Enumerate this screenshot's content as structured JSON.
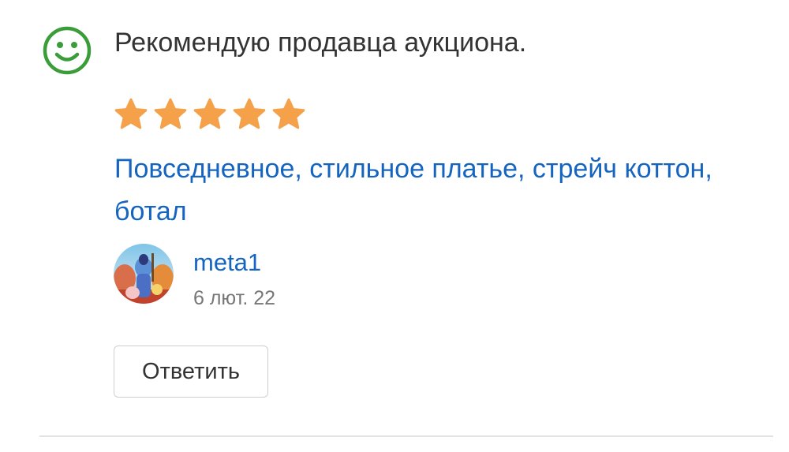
{
  "review": {
    "sentiment_icon": "smiley-positive-icon",
    "sentiment_color": "#3a9d3a",
    "verdict": "Рекомендую продавца аукциона.",
    "rating": 5,
    "rating_max": 5,
    "star_color": "#f5a14a",
    "item_title": "Повседневное, стильное платье, стрейч коттон, ботал",
    "link_color": "#1565c0",
    "author": {
      "username": "meta1",
      "date": "6 лют. 22",
      "avatar": "avatar-image"
    },
    "reply_label": "Ответить"
  }
}
